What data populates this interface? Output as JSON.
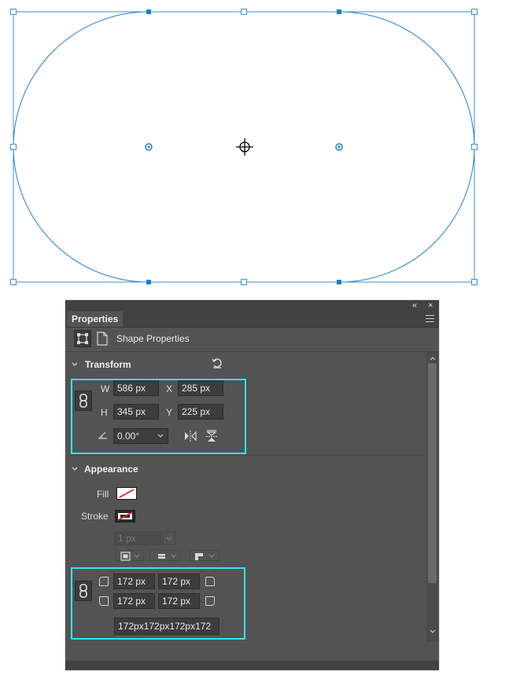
{
  "app": {
    "panel_title": "Properties",
    "shape_properties_label": "Shape Properties"
  },
  "transform": {
    "title": "Transform",
    "w_label": "W",
    "w_value": "586 px",
    "x_label": "X",
    "x_value": "285 px",
    "h_label": "H",
    "h_value": "345 px",
    "y_label": "Y",
    "y_value": "225 px",
    "rotation_value": "0.00°"
  },
  "appearance": {
    "title": "Appearance",
    "fill_label": "Fill",
    "stroke_label": "Stroke",
    "stroke_width_value": "1 px"
  },
  "corners": {
    "top_left": "172 px",
    "top_right": "172 px",
    "bottom_left": "172 px",
    "bottom_right": "172 px",
    "combined": "172px172px172px172"
  },
  "colors": {
    "accent": "#2ce6f0",
    "shape_stroke": "#1f7fd4",
    "panel_bg": "#535353",
    "panel_header": "#424242"
  },
  "icons": [
    "shape-tool-icon",
    "document-icon",
    "reset-icon",
    "link-icon",
    "rotate-angle-icon",
    "flip-horizontal-icon",
    "flip-vertical-icon",
    "menu-icon",
    "collapse-icon",
    "close-icon",
    "chevron-down-icon",
    "corner-icon"
  ]
}
